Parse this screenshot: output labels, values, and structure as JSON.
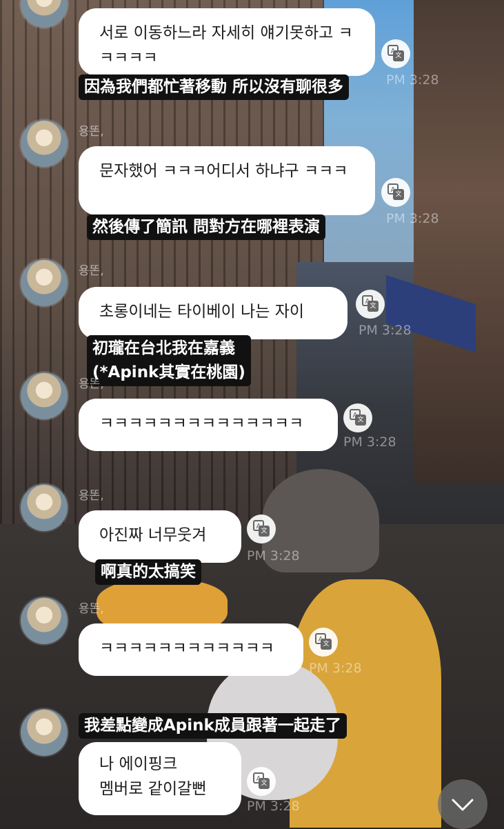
{
  "messages": [
    {
      "sender": "",
      "text": "서로 이동하느라 자세히 얘기못하고 ㅋㅋㅋㅋㅋ",
      "time": "PM 3:28",
      "caption": "因為我們都忙著移動 所以沒有聊很多"
    },
    {
      "sender": "용똔,",
      "text": "문자했어 ㅋㅋㅋ어디서 하냐구 ㅋㅋㅋ",
      "time": "PM 3:28",
      "caption": "然後傳了簡訊 問對方在哪裡表演"
    },
    {
      "sender": "용똔,",
      "text": "초롱이네는 타이베이 나는 자이",
      "time": "PM 3:28",
      "caption_lines": [
        "初瓏在台北我在嘉義",
        "(*Apink其實在桃園)"
      ]
    },
    {
      "sender": "용똔,",
      "text": "ㅋㅋㅋㅋㅋㅋㅋㅋㅋㅋㅋㅋㅋㅋ",
      "time": "PM 3:28"
    },
    {
      "sender": "용똔,",
      "text": "아진짜 너무웃겨",
      "time": "PM 3:28",
      "caption": "啊真的太搞笑"
    },
    {
      "sender": "용똔,",
      "text": "ㅋㅋㅋㅋㅋㅋㅋㅋㅋㅋㅋㅋ",
      "time": "PM 3:28"
    },
    {
      "sender": "",
      "text_lines": [
        "나 에이핑크",
        "멤버로 같이갈뻔"
      ],
      "time": "PM 3:28",
      "caption": "我差點變成Apink成員跟著一起走了"
    }
  ],
  "icons": {
    "translate": "translate-icon",
    "scroll": "chevron-down-icon"
  }
}
